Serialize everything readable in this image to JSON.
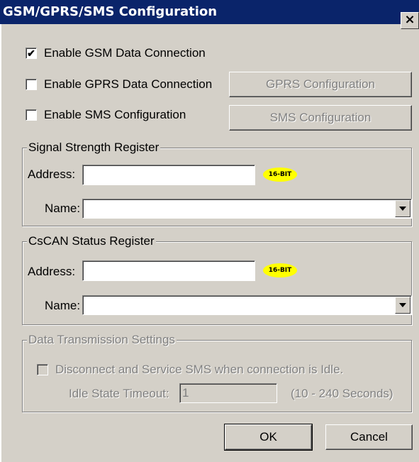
{
  "window": {
    "title": "GSM/GPRS/SMS Configuration",
    "close_glyph": "×"
  },
  "options": {
    "gsm": {
      "label": "Enable GSM Data Connection",
      "checked": true,
      "check_glyph": "✔"
    },
    "gprs": {
      "label": "Enable GPRS Data Connection",
      "checked": false,
      "button_label": "GPRS Configuration"
    },
    "sms": {
      "label": "Enable SMS Configuration",
      "checked": false,
      "button_label": "SMS Configuration"
    }
  },
  "signal_group": {
    "title": "Signal Strength Register",
    "address_label": "Address:",
    "address_value": "",
    "badge": "16-BIT",
    "name_label": "Name:",
    "name_value": ""
  },
  "cscan_group": {
    "title": "CsCAN Status Register",
    "address_label": "Address:",
    "address_value": "",
    "badge": "16-BIT",
    "name_label": "Name:",
    "name_value": ""
  },
  "transmission_group": {
    "title": "Data Transmission Settings",
    "disconnect_label": "Disconnect and Service SMS when  connection is Idle.",
    "timeout_label": "Idle State Timeout:",
    "timeout_value": "1",
    "range_text": "(10 - 240 Seconds)"
  },
  "footer": {
    "ok_label": "OK",
    "cancel_label": "Cancel"
  },
  "colors": {
    "titlebar": "#0a246a",
    "face": "#d4d0c8",
    "badge": "#ffff00"
  }
}
